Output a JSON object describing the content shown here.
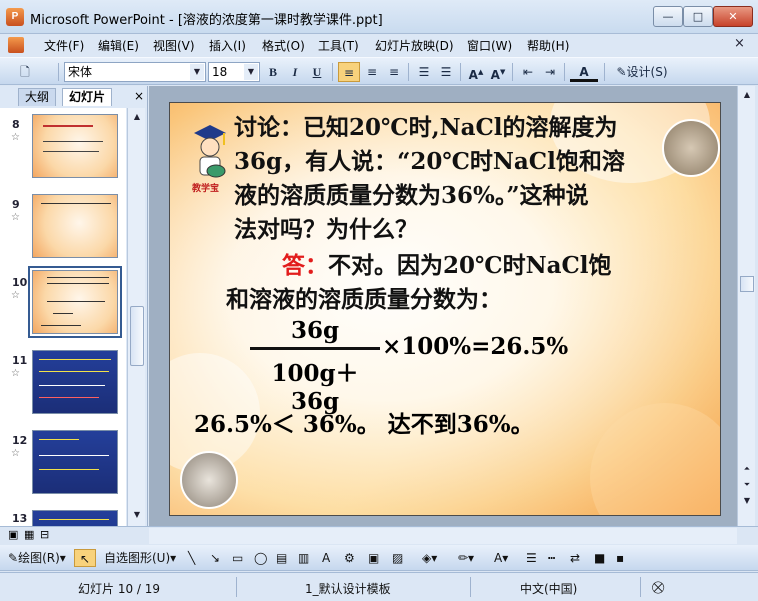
{
  "window": {
    "title": "Microsoft PowerPoint - [溶液的浓度第一课时教学课件.ppt]",
    "app_icon": "powerpoint-icon",
    "min": "—",
    "max": "□",
    "close": "✕"
  },
  "menu": {
    "items": [
      "文件(F)",
      "编辑(E)",
      "视图(V)",
      "插入(I)",
      "格式(O)",
      "工具(T)",
      "幻灯片放映(D)",
      "窗口(W)",
      "帮助(H)"
    ],
    "close_x": "×"
  },
  "toolbar": {
    "font": "宋体",
    "size": "18",
    "bold": "B",
    "italic": "I",
    "underline": "U",
    "design": "设计(S)",
    "font_color_label": "A"
  },
  "left_pane": {
    "tabs": [
      "大纲",
      "幻灯片"
    ],
    "close_x": "×",
    "thumbnails": [
      {
        "num": "8",
        "style": "light"
      },
      {
        "num": "9",
        "style": "light"
      },
      {
        "num": "10",
        "style": "light",
        "selected": true
      },
      {
        "num": "11",
        "style": "dark"
      },
      {
        "num": "12",
        "style": "dark"
      },
      {
        "num": "13",
        "style": "dark"
      }
    ]
  },
  "slide": {
    "teacher_label": "教学宝",
    "question_lines": [
      "讨论：已知20℃时,NaCl的溶解度为",
      "36g，有人说：“20℃时NaCl饱和溶",
      "液的溶质质量分数为36%。”这种说",
      "法对吗？为什么？"
    ],
    "answer_label": "答：",
    "answer_line1": "不对。因为20℃时NaCl饱",
    "answer_line2": "和溶液的溶质质量分数为：",
    "fraction_numerator": "36g",
    "fraction_denominator": "100g＋36g",
    "fraction_result": "×100%=26.5%",
    "conclusion": "26.5%＜ 36%。 达不到36%。"
  },
  "drawing_toolbar": {
    "draw": "绘图(R)",
    "autoshapes": "自选图形(U)"
  },
  "status": {
    "slide": "幻灯片 10 / 19",
    "template": "1_默认设计模板",
    "language": "中文(中国)"
  }
}
